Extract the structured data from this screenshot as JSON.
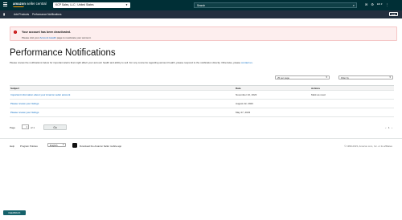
{
  "topbar": {
    "logo_strong": "amazon",
    "logo_rest": "seller central",
    "store_name": "KCP Sales, LLC",
    "store_region": "United States",
    "search_placeholder": "Search",
    "lang": "EN"
  },
  "secondary_nav": {
    "link1": "Add Products",
    "link2": "Performance Notifications",
    "edit": "Edit"
  },
  "alert": {
    "title": "Your account has been deactivated.",
    "text_before": "Please visit your ",
    "link": "Account Health",
    "text_after": " page to reactivate your account."
  },
  "page": {
    "title": "Performance Notifications",
    "desc": "Please review the notifications below for important alerts that might affect your account health and ability to sell. For any concerns regarding account health, please respond to the notification directly. Otherwise, please ",
    "desc_link": "contact us",
    "desc_end": "."
  },
  "controls": {
    "per_page": "25 per page",
    "filter": "Filter by"
  },
  "table": {
    "headers": [
      "Subject",
      "Date",
      "Actions"
    ],
    "rows": [
      {
        "subject": "Important information about your Amazon seller account",
        "date": "November 10, 2023",
        "action": "Mark as read"
      },
      {
        "subject": "Please review your listings",
        "date": "August 22, 2023",
        "action": ""
      },
      {
        "subject": "Please review your listings",
        "date": "May 27, 2023",
        "action": ""
      }
    ]
  },
  "pager": {
    "page_label": "Page",
    "page_value": "1",
    "of_label": "of 1",
    "go": "Go",
    "prev": "‹",
    "current": "1",
    "next": "›"
  },
  "footer": {
    "help": "Help",
    "policies": "Program Policies",
    "language": "English",
    "app_text": "Download the Amazon Seller mobile app",
    "copyright": "© 1999-2023, Amazon.com, Inc. or its affiliates"
  },
  "feedback": "FEEDBACK"
}
